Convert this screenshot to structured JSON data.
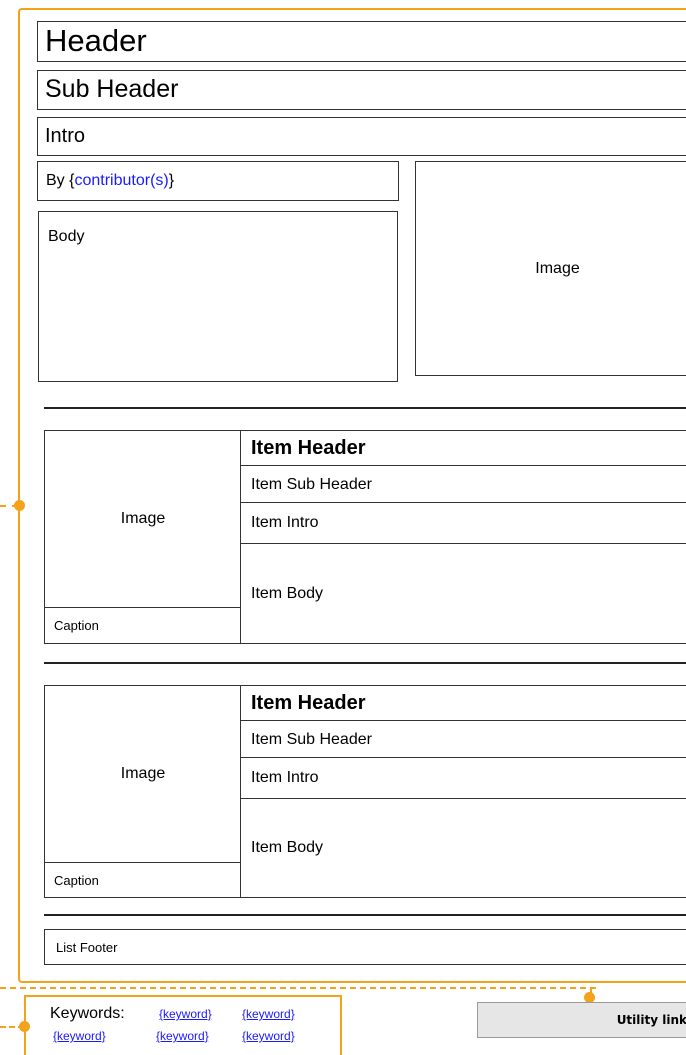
{
  "article": {
    "header": "Header",
    "sub_header": "Sub Header",
    "intro": "Intro",
    "by_prefix": "By {",
    "contributor": "contributor(s)",
    "by_suffix": "}",
    "body": "Body",
    "image": "Image"
  },
  "items": [
    {
      "image": "Image",
      "caption": "Caption",
      "header": "Item Header",
      "sub_header": "Item Sub Header",
      "intro": "Item Intro",
      "body": "Item Body"
    },
    {
      "image": "Image",
      "caption": "Caption",
      "header": "Item Header",
      "sub_header": "Item Sub Header",
      "intro": "Item Intro",
      "body": "Item Body"
    }
  ],
  "list_footer": "List Footer",
  "keywords": {
    "label": "Keywords:",
    "links": [
      "{keyword}",
      "{keyword}",
      "{keyword}",
      "{keyword}",
      "{keyword}"
    ]
  },
  "utility": {
    "label": "Utility link"
  },
  "colors": {
    "accent": "#f5a21b",
    "link": "#1a1aff",
    "utility_bg": "#e6e6e6"
  }
}
